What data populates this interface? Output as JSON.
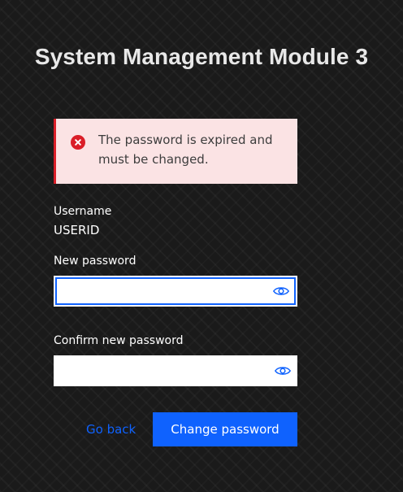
{
  "page": {
    "title": "System Management Module 3"
  },
  "alert": {
    "icon": "error-icon",
    "message": "The password is expired and must be changed.",
    "color": "#da1e28",
    "background": "#fbe3e4"
  },
  "form": {
    "username_label": "Username",
    "username_value": "USERID",
    "new_password_label": "New password",
    "new_password_value": "",
    "confirm_password_label": "Confirm new password",
    "confirm_password_value": "",
    "password_toggle_icon": "eye-icon"
  },
  "actions": {
    "go_back_label": "Go back",
    "change_password_label": "Change password",
    "accent": "#0f62fe"
  }
}
